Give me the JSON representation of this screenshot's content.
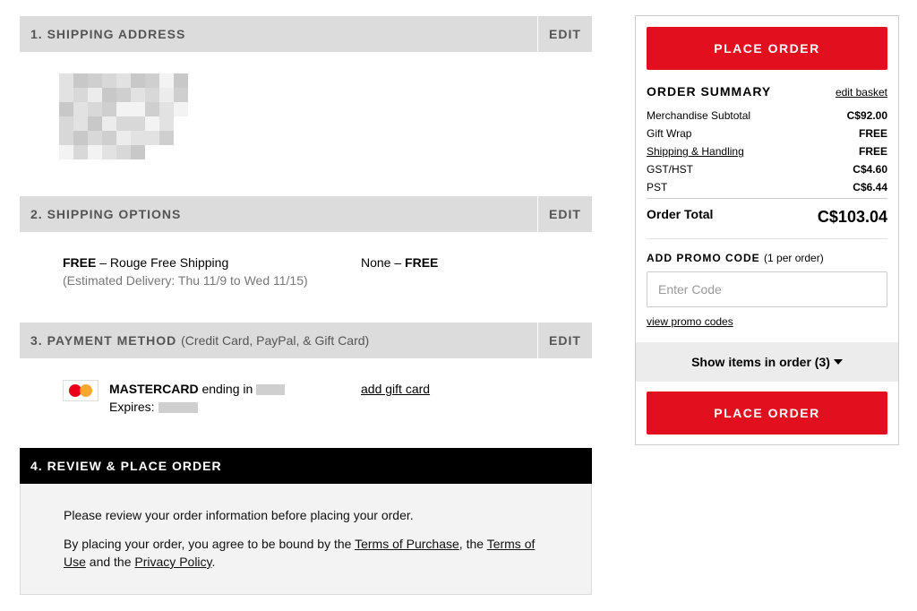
{
  "sections": {
    "shipping_address": {
      "title": "1. SHIPPING ADDRESS",
      "edit": "EDIT"
    },
    "shipping_options": {
      "title": "2. SHIPPING OPTIONS",
      "edit": "EDIT"
    },
    "payment_method": {
      "title": "3. PAYMENT METHOD",
      "subtitle": "(Credit Card, PayPal, & Gift Card)",
      "edit": "EDIT"
    },
    "review": {
      "title": "4. REVIEW & PLACE ORDER"
    }
  },
  "shipping_option": {
    "price": "FREE",
    "separator": " – ",
    "name": "Rouge Free Shipping",
    "estimate": "(Estimated Delivery: Thu 11/9 to Wed 11/15)",
    "gift_label": "None – ",
    "gift_price": "FREE"
  },
  "payment": {
    "card_brand": "MASTERCARD",
    "ending_text": " ending in",
    "expires_label": "Expires:",
    "add_gift_card": "add gift card",
    "card_icon": "mastercard-icon"
  },
  "review": {
    "line1": "Please review your order information before placing your order.",
    "line2_prefix": "By placing your order, you agree to be bound by the ",
    "terms_purchase": "Terms of Purchase",
    "line2_mid1": ", the ",
    "terms_use_a": "Terms of",
    "terms_use_b": "Use",
    "line2_mid2": " and the ",
    "privacy": "Privacy Policy",
    "line2_end": "."
  },
  "summary": {
    "place_order": "PLACE ORDER",
    "title": "ORDER SUMMARY",
    "edit_basket": "edit basket",
    "rows": [
      {
        "label": "Merchandise Subtotal",
        "value": "C$92.00"
      },
      {
        "label": "Gift Wrap",
        "value": "FREE"
      },
      {
        "label": "Shipping & Handling",
        "value": "FREE"
      },
      {
        "label": "GST/HST",
        "value": "C$4.60"
      },
      {
        "label": "PST",
        "value": "C$6.44"
      }
    ],
    "total_label": "Order Total",
    "total_value": "C$103.04",
    "promo_title": "ADD PROMO CODE",
    "promo_sub": "(1 per order)",
    "promo_placeholder": "Enter Code",
    "view_promo": "view promo codes",
    "show_items": "Show items in order (3)"
  },
  "colors": {
    "accent_red": "#e2101f",
    "header_gray": "#dcdcdc",
    "review_header": "#000000"
  }
}
